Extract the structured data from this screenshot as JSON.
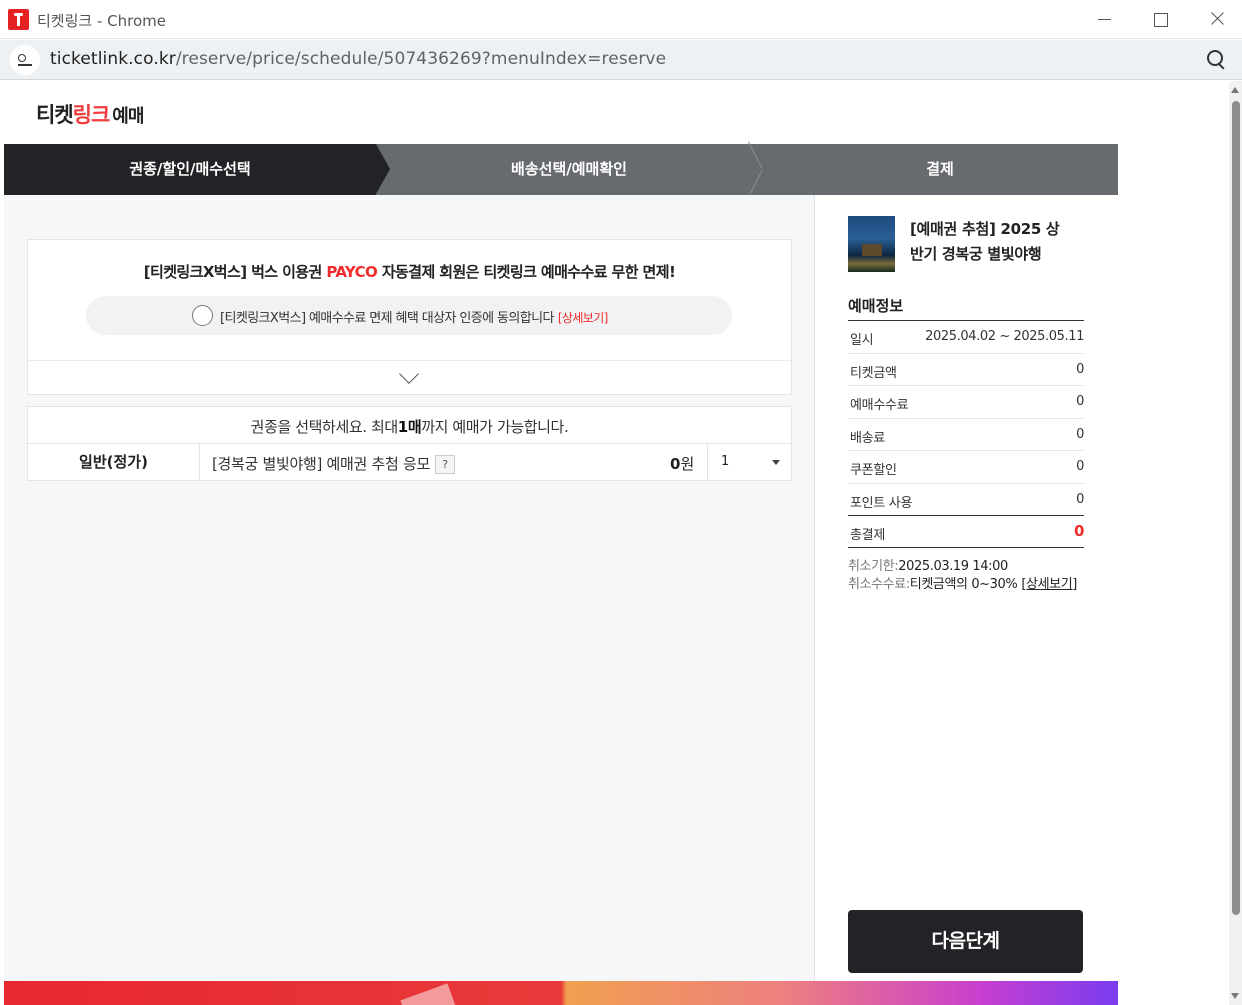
{
  "window": {
    "title": "티켓링크 - Chrome"
  },
  "address": {
    "domain": "ticketlink.co.kr",
    "path": "/reserve/price/schedule/507436269?menuIndex=reserve"
  },
  "logo": {
    "part1": "티켓",
    "part2": "링크",
    "part3": "예매"
  },
  "steps": [
    {
      "label": "권종/할인/매수선택"
    },
    {
      "label": "배송선택/예매확인"
    },
    {
      "label": "결제"
    }
  ],
  "promo": {
    "title_before": "[티켓링크X벅스] 벅스 이용권 ",
    "title_payco": "PAYCO",
    "title_after": " 자동결제 회원은 티켓링크 예매수수료 무한 면제!",
    "consent_text": "[티켓링크X벅스] 예매수수료 면제 혜택 대상자 인증에 동의합니다",
    "detail_link": "[상세보기]"
  },
  "ticket": {
    "hint_before": "권종을 선택하세요. 최대",
    "hint_bold": "1매",
    "hint_after": "까지 예매가 가능합니다.",
    "grade": "일반(정가)",
    "name": "[경복궁 별빛야행] 예매권 추첨 응모",
    "help": "?",
    "price_num": "0",
    "price_unit": "원",
    "qty": "1"
  },
  "sidebar": {
    "show_title": "[예매권 추첨] 2025 상반기 경복궁 별빛야행",
    "info_title": "예매정보",
    "rows": [
      {
        "k": "일시",
        "v": "2025.04.02 ~ 2025.05.11"
      },
      {
        "k": "티켓금액",
        "v": "0"
      },
      {
        "k": "예매수수료",
        "v": "0"
      },
      {
        "k": "배송료",
        "v": "0"
      },
      {
        "k": "쿠폰할인",
        "v": "0"
      },
      {
        "k": "포인트 사용",
        "v": "0"
      }
    ],
    "total": {
      "k": "총결제",
      "v": "0"
    },
    "cancel_deadline_label": "취소기한:",
    "cancel_deadline_value": "2025.03.19 14:00",
    "cancel_fee_label": "취소수수료:",
    "cancel_fee_value": "티켓금액의 0~30%",
    "cancel_fee_link": "[상세보기]",
    "next_button": "다음단계"
  },
  "colors": {
    "accent": "#ef2b2b",
    "dark": "#222326",
    "step_bg": "#676a6e"
  }
}
